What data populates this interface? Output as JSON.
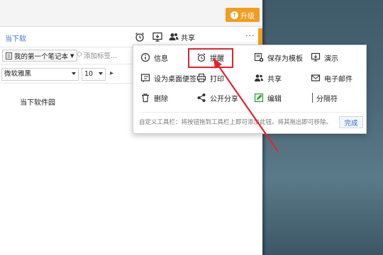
{
  "toolbar": {
    "upgrade_label": "升级",
    "share_label": "共享",
    "more_label": "···"
  },
  "note": {
    "title": "当下软",
    "body": "当下软件园"
  },
  "notebook": {
    "name": "我的第一个笔记本",
    "add_tag": "添加标签..."
  },
  "format": {
    "font": "微软雅黑",
    "size": "10"
  },
  "popup": {
    "items": [
      {
        "label": "信息",
        "icon": "info-icon"
      },
      {
        "label": "提醒",
        "icon": "alarm-clock-icon"
      },
      {
        "label": "保存为模板",
        "icon": "save-template-icon"
      },
      {
        "label": "演示",
        "icon": "presentation-icon"
      },
      {
        "label": "设为桌面便签",
        "icon": "sticky-note-icon"
      },
      {
        "label": "打印",
        "icon": "printer-icon"
      },
      {
        "label": "共享",
        "icon": "users-icon"
      },
      {
        "label": "电子邮件",
        "icon": "mail-icon"
      },
      {
        "label": "删除",
        "icon": "trash-icon"
      },
      {
        "label": "公开分享",
        "icon": "share-icon"
      },
      {
        "label": "编辑",
        "icon": "edit-icon"
      },
      {
        "label": "分隔符",
        "icon": "separator-icon"
      }
    ],
    "hint": "自定义工具栏：将按钮拖到工具栏上即可添加此钮。将其拖出即可移除。",
    "done_label": "完成"
  },
  "colors": {
    "accent": "#f29c1f",
    "highlight": "#e1252c",
    "link": "#3a76c2"
  }
}
